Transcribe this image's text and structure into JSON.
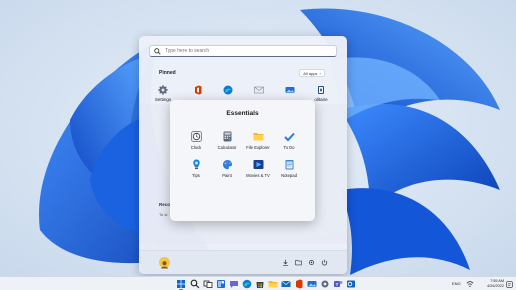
{
  "start_menu": {
    "search": {
      "placeholder": "Type here to search"
    },
    "pinned_label": "Pinned",
    "all_apps_label": "All apps",
    "all_apps_chevron": "›",
    "pinned": [
      {
        "label": "Settings",
        "icon": "gear-icon"
      },
      {
        "label": "",
        "icon": "office-icon"
      },
      {
        "label": "",
        "icon": "edge-icon"
      },
      {
        "label": "",
        "icon": "mail-icon"
      },
      {
        "label": "",
        "icon": "photos-icon"
      },
      {
        "label": "",
        "icon": "store-icon"
      },
      {
        "label": "olitaire",
        "icon": "solitaire-icon"
      }
    ],
    "recommended_label": "Reco",
    "recommended_sub": "To st",
    "footer_icons": [
      "downloads-icon",
      "folder-icon",
      "settings-icon",
      "power-icon"
    ]
  },
  "folder": {
    "title": "Essentials",
    "apps": [
      {
        "label": "Clock",
        "icon": "clock-icon"
      },
      {
        "label": "Calculator",
        "icon": "calculator-icon"
      },
      {
        "label": "File Explorer",
        "icon": "file-explorer-icon"
      },
      {
        "label": "To Do",
        "icon": "todo-icon"
      },
      {
        "label": "Tips",
        "icon": "tips-icon"
      },
      {
        "label": "Paint",
        "icon": "paint-icon"
      },
      {
        "label": "Movies & TV",
        "icon": "movies-icon"
      },
      {
        "label": "Notepad",
        "icon": "notepad-icon"
      }
    ]
  },
  "taskbar": {
    "apps": [
      "start-icon",
      "search-icon",
      "task-view-icon",
      "widgets-icon",
      "chat-icon",
      "edge-icon",
      "store-icon",
      "file-explorer-icon",
      "mail-icon",
      "office-icon",
      "photos-icon",
      "settings-icon",
      "teams-icon",
      "outlook-icon"
    ],
    "language": "ENG",
    "time": "7:55 AM",
    "date": "4/26/2022"
  },
  "colors": {
    "accent": "#0067c0",
    "wallpaper_bloom": "#1a5fd6",
    "wallpaper_bg": "#d7e4f2"
  }
}
